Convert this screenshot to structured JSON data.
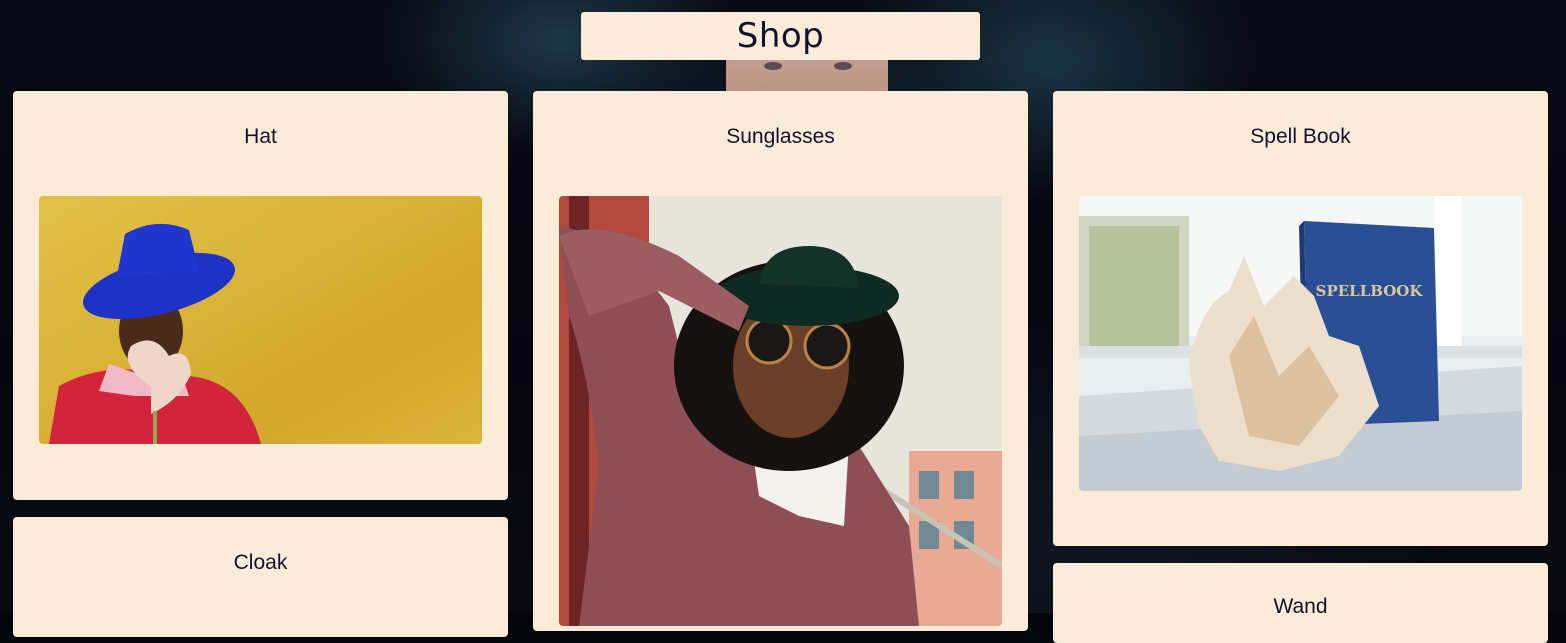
{
  "page": {
    "title": "Shop"
  },
  "products": [
    {
      "name": "Hat"
    },
    {
      "name": "Sunglasses"
    },
    {
      "name": "Spell Book"
    },
    {
      "name": "Cloak"
    },
    {
      "name": "Wand"
    }
  ],
  "images": {
    "spellbook_cover_text": "SPELLBOOK"
  },
  "colors": {
    "card_bg": "#fbecd9",
    "text": "#13122e",
    "page_bg": "#05060b"
  }
}
